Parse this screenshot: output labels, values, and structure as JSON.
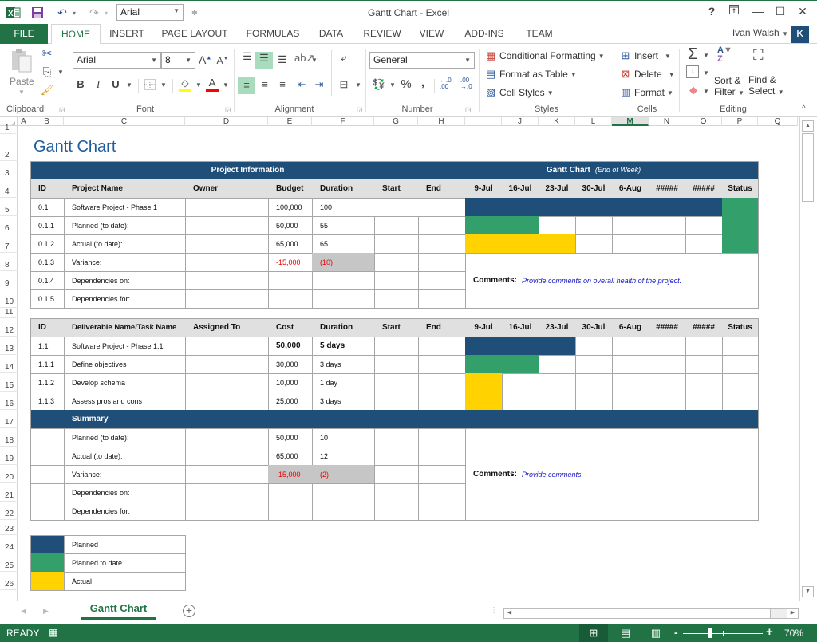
{
  "window": {
    "title": "Gantt Chart - Excel",
    "quick_access_font": "Arial",
    "help": "?",
    "restore_ribbon": "⊼",
    "minimize": "—",
    "maximize": "☐",
    "close": "✕"
  },
  "tabs": [
    "FILE",
    "HOME",
    "INSERT",
    "PAGE LAYOUT",
    "FORMULAS",
    "DATA",
    "REVIEW",
    "VIEW",
    "ADD-INS",
    "TEAM"
  ],
  "user": {
    "name": "Ivan Walsh",
    "avatar_letter": "K"
  },
  "ribbon": {
    "clipboard": {
      "label": "Clipboard",
      "paste": "Paste"
    },
    "font": {
      "label": "Font",
      "name": "Arial",
      "size": "8",
      "bold": "B",
      "italic": "I",
      "underline": "U"
    },
    "alignment": {
      "label": "Alignment"
    },
    "number": {
      "label": "Number",
      "format": "General",
      "percent": "%",
      "comma": ","
    },
    "styles": {
      "label": "Styles",
      "conditional_formatting": "Conditional Formatting",
      "format_as_table": "Format as Table",
      "cell_styles": "Cell Styles"
    },
    "cells": {
      "label": "Cells",
      "insert": "Insert",
      "delete": "Delete",
      "format": "Format"
    },
    "editing": {
      "label": "Editing",
      "sort_filter_1": "Sort &",
      "sort_filter_2": "Filter",
      "find_select_1": "Find &",
      "find_select_2": "Select"
    }
  },
  "columns": [
    "A",
    "B",
    "C",
    "D",
    "E",
    "F",
    "G",
    "H",
    "I",
    "J",
    "K",
    "L",
    "M",
    "N",
    "O",
    "P",
    "Q"
  ],
  "selected_column": "M",
  "rows": [
    "1",
    "2",
    "3",
    "4",
    "5",
    "6",
    "7",
    "8",
    "9",
    "10",
    "11",
    "12",
    "13",
    "14",
    "15",
    "16",
    "17",
    "18",
    "19",
    "20",
    "21",
    "22",
    "23",
    "24",
    "25",
    "26"
  ],
  "sheet": {
    "title": "Gantt Chart",
    "project_info_header": "Project Information",
    "gantt_header": "Gantt Chart",
    "gantt_header_sub": "(End of Week)",
    "table1_headers": [
      "ID",
      "Project Name",
      "Owner",
      "Budget",
      "Duration",
      "Start",
      "End"
    ],
    "week_headers": [
      "9-Jul",
      "16-Jul",
      "23-Jul",
      "30-Jul",
      "6-Aug",
      "#####",
      "#####"
    ],
    "status_header": "Status",
    "table1_rows": [
      {
        "id": "0.1",
        "name": "Software Project - Phase 1",
        "owner": "",
        "budget": "100,000",
        "duration": "100",
        "start": "",
        "end": "",
        "bars": [
          "navy",
          "navy",
          "navy",
          "navy",
          "navy",
          "navy",
          "navy"
        ]
      },
      {
        "id": "0.1.1",
        "name": "Planned (to date):",
        "owner": "",
        "budget": "50,000",
        "duration": "55",
        "start": "",
        "end": "",
        "bars": [
          "green",
          "green",
          "",
          "",
          "",
          "",
          ""
        ]
      },
      {
        "id": "0.1.2",
        "name": "Actual (to date):",
        "owner": "",
        "budget": "65,000",
        "duration": "65",
        "start": "",
        "end": "",
        "bars": [
          "yellow",
          "yellow",
          "yellow",
          "",
          "",
          "",
          ""
        ]
      },
      {
        "id": "0.1.3",
        "name": "Variance:",
        "owner": "",
        "budget": "-15,000",
        "duration": "(10)",
        "start": "",
        "end": ""
      },
      {
        "id": "0.1.4",
        "name": "Dependencies on:",
        "owner": "",
        "budget": "",
        "duration": "",
        "start": "",
        "end": ""
      },
      {
        "id": "0.1.5",
        "name": "Dependencies for:",
        "owner": "",
        "budget": "",
        "duration": "",
        "start": "",
        "end": ""
      }
    ],
    "status_color": "#339f6b",
    "comments1_label": "Comments:",
    "comments1_text": "Provide comments on overall health of the project.",
    "table2_headers": [
      "ID",
      "Deliverable Name/Task Name",
      "Assigned To",
      "Cost",
      "Duration",
      "Start",
      "End"
    ],
    "table2_rows": [
      {
        "id": "1.1",
        "name": "Software Project - Phase 1.1",
        "assigned": "",
        "cost": "50,000",
        "duration": "5 days",
        "bold": true,
        "bars": [
          "navy",
          "navy",
          "navy",
          "",
          "",
          "",
          ""
        ]
      },
      {
        "id": "1.1.1",
        "name": "Define objectives",
        "assigned": "",
        "cost": "30,000",
        "duration": "3 days",
        "bars": [
          "green",
          "green",
          "",
          "",
          "",
          "",
          ""
        ]
      },
      {
        "id": "1.1.2",
        "name": "Develop schema",
        "assigned": "",
        "cost": "10,000",
        "duration": "1 day",
        "bars": [
          "yellow",
          "",
          "",
          "",
          "",
          "",
          ""
        ]
      },
      {
        "id": "1.1.3",
        "name": "Assess pros and cons",
        "assigned": "",
        "cost": "25,000",
        "duration": "3 days",
        "bars": [
          "yellow",
          "",
          "",
          "",
          "",
          "",
          ""
        ]
      }
    ],
    "summary_label": "Summary",
    "summary_rows": [
      {
        "name": "Planned (to date):",
        "cost": "50,000",
        "duration": "10"
      },
      {
        "name": "Actual (to date):",
        "cost": "65,000",
        "duration": "12"
      },
      {
        "name": "Variance:",
        "cost": "-15,000",
        "duration": "(2)"
      },
      {
        "name": "Dependencies on:",
        "cost": "",
        "duration": ""
      },
      {
        "name": "Dependencies for:",
        "cost": "",
        "duration": ""
      }
    ],
    "comments2_label": "Comments:",
    "comments2_text": "Provide comments.",
    "legend": [
      {
        "color": "#1f4e79",
        "label": "Planned"
      },
      {
        "color": "#339f6b",
        "label": "Planned to date"
      },
      {
        "color": "#ffd200",
        "label": "Actual"
      }
    ]
  },
  "sheet_tabs": [
    "Gantt Chart"
  ],
  "status": {
    "ready": "READY",
    "zoom": "70%",
    "zoom_minus": "-",
    "zoom_plus": "+"
  }
}
